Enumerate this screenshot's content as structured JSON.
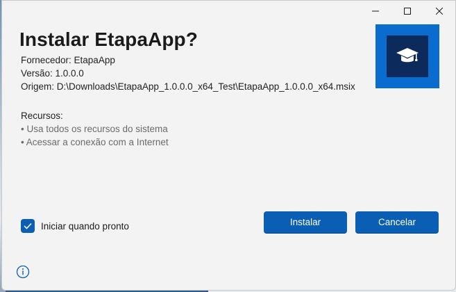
{
  "dialog": {
    "title": "Instalar EtapaApp?",
    "publisher": "Fornecedor: EtapaApp",
    "version": "Versão: 1.0.0.0",
    "origin": "Origem: D:\\Downloads\\EtapaApp_1.0.0.0_x64_Test\\EtapaApp_1.0.0.0_x64.msix",
    "resources_heading": "Recursos:",
    "resources": [
      "• Usa todos os recursos do sistema",
      "• Acessar a conexão com a Internet"
    ],
    "launch_checkbox": {
      "label": "Iniciar quando pronto",
      "checked": true
    },
    "install_button": "Instalar",
    "cancel_button": "Cancelar"
  },
  "icons": {
    "app": "graduation-cap-icon",
    "info": "info-icon",
    "minimize": "minimize-icon",
    "maximize": "maximize-icon",
    "close": "close-icon"
  },
  "colors": {
    "accent": "#0a5fb4",
    "app_tile": "#0a6ccf",
    "app_tile_inner": "#0d2a5c",
    "window_bg": "#f3f3f3"
  }
}
